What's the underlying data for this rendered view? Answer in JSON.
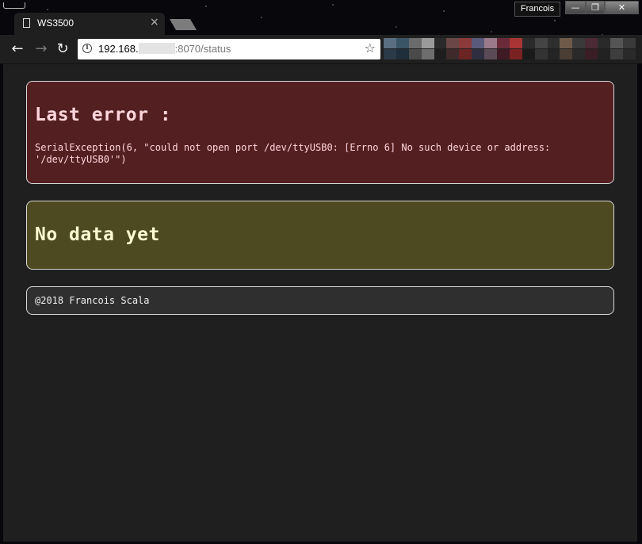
{
  "browser": {
    "user_name": "Francois",
    "tab_title": "WS3500",
    "tab_close": "×",
    "url_host": "192.168.",
    "url_port_path": ":8070/status",
    "window_buttons": {
      "minimize": "—",
      "maximize": "❐",
      "close": "✕"
    }
  },
  "bookmark_colors": [
    "#5b6f82",
    "#3a5566",
    "#6b6b6b",
    "#9a9a9a",
    "#2a2a2a",
    "#6a4646",
    "#8a3a3a",
    "#5a5a7a",
    "#9a7a8a",
    "#6a2a3a",
    "#a83434",
    "#2a2a2a",
    "#444",
    "#2e2e2e",
    "#6f5a4a",
    "#3a3a3a",
    "#4a2a34",
    "#2a2a2a",
    "#555",
    "#3a3a3a",
    "#2a3a48",
    "#1e2e3a",
    "#4a4a4a",
    "#6e6e6e",
    "#1e1e1e",
    "#3e2a2a",
    "#6a2424",
    "#2e2e3e",
    "#5a4a56",
    "#3e1a24",
    "#7a2222",
    "#1a1a1a",
    "#333",
    "#242424",
    "#4a3e34",
    "#2a2a2a",
    "#3a1e26",
    "#222",
    "#3e3e3e",
    "#2a2a2a"
  ],
  "page": {
    "error_title": "Last error :",
    "error_message": "SerialException(6, \"could not open port /dev/ttyUSB0: [Errno 6] No such device or address: '/dev/ttyUSB0'\")",
    "no_data_title": "No data yet",
    "footer_text": "@2018 Francois Scala"
  }
}
